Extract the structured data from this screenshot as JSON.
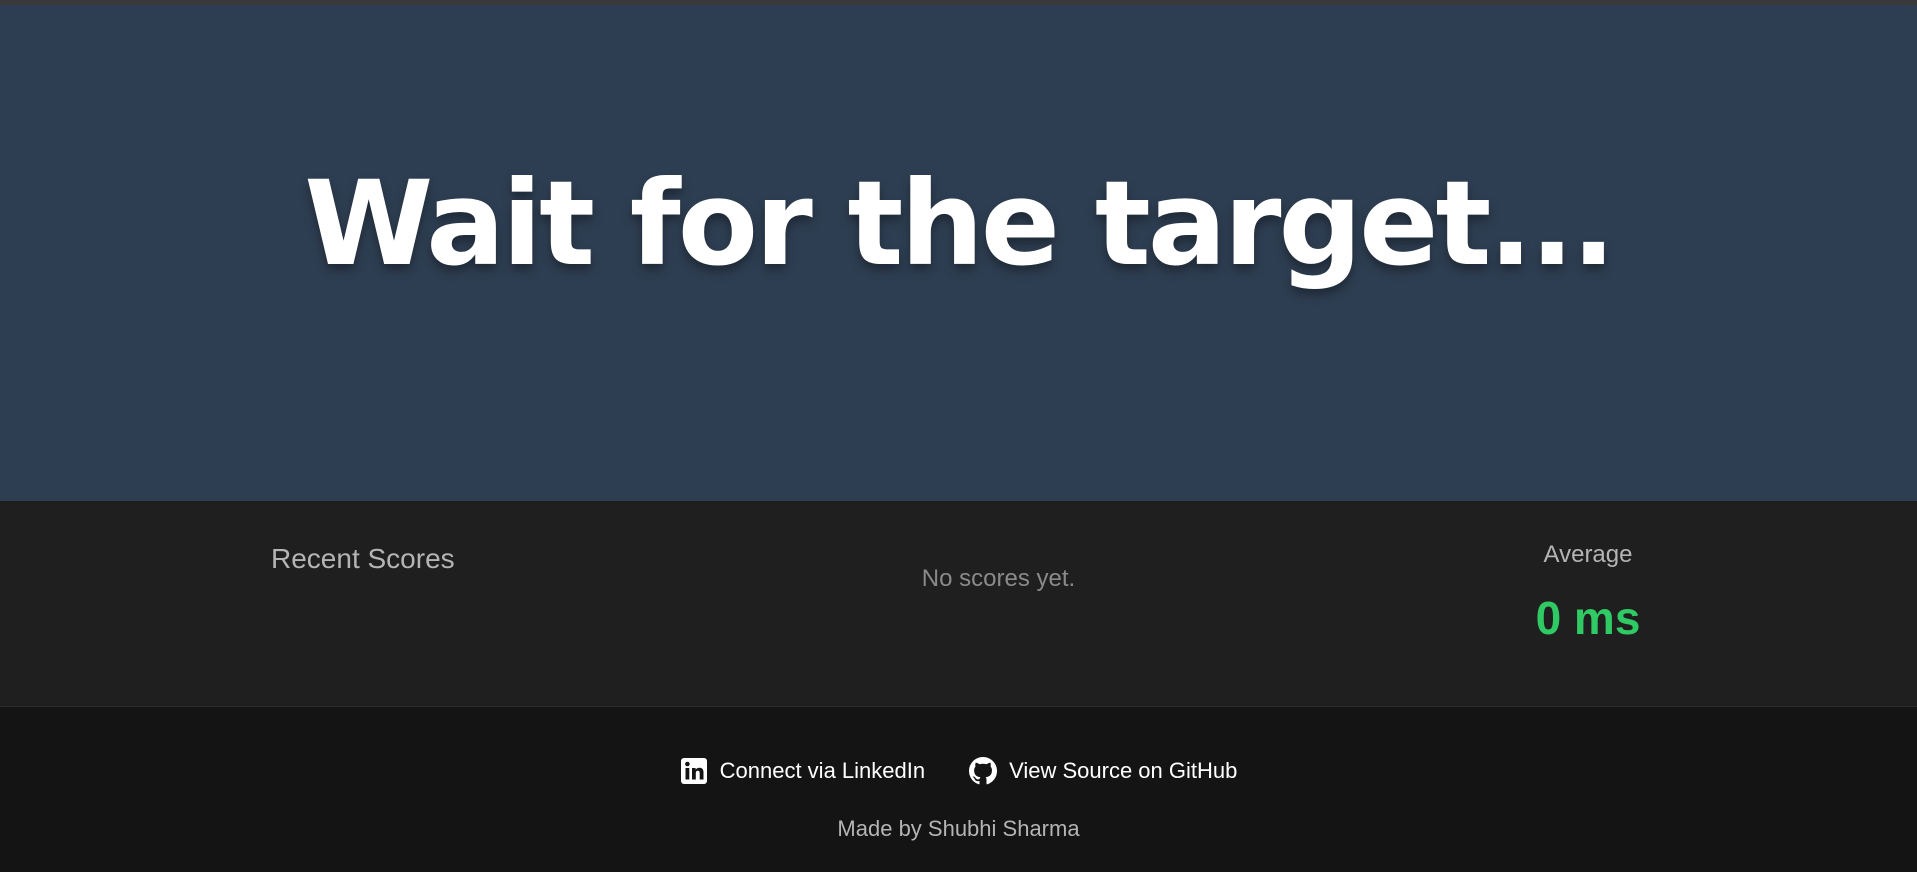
{
  "hero": {
    "title": "Wait for the target..."
  },
  "scores": {
    "recent_title": "Recent Scores",
    "empty_message": "No scores yet.",
    "average_label": "Average",
    "average_value": "0 ms"
  },
  "footer": {
    "linkedin_label": "Connect via LinkedIn",
    "github_label": "View Source on GitHub",
    "made_by": "Made by Shubhi Sharma"
  },
  "icons": {
    "linkedin": "linkedin-icon",
    "github": "github-icon"
  },
  "colors": {
    "hero_background": "#2e3e52",
    "scores_background": "#1f1f1f",
    "footer_background": "#141414",
    "average_accent": "#2fca63"
  }
}
